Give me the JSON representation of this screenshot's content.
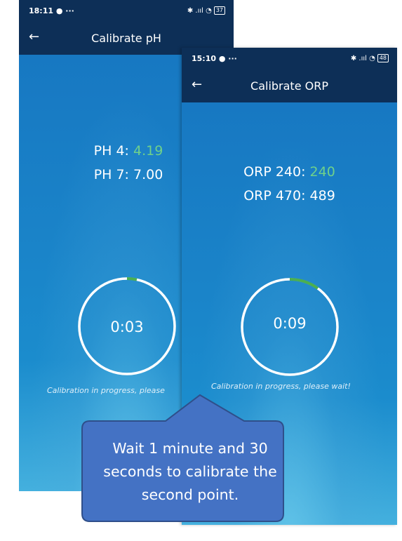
{
  "ph_screen": {
    "status_time": "18:11",
    "status_dots": "● ···",
    "status_icons": "✱ .ııl ◔",
    "battery": "37",
    "title": "Calibrate pH",
    "reading_1_label": "PH 4:",
    "reading_1_value": "4.19",
    "reading_2": "PH 7: 7.00",
    "timer": "0:03",
    "progress_fraction": 0.033,
    "message": "Calibration in progress, please"
  },
  "orp_screen": {
    "status_time": "15:10",
    "status_dots": "● ···",
    "status_icons": "✱ .ııl ◔",
    "battery": "48",
    "title": "Calibrate ORP",
    "reading_1_label": "ORP 240:",
    "reading_1_value": "240",
    "reading_2": "ORP 470: 489",
    "timer": "0:09",
    "progress_fraction": 0.1,
    "message": "Calibration in progress, please wait!"
  },
  "callout": {
    "text_line_1": "Wait 1 minute and 30",
    "text_line_2": "seconds to calibrate the",
    "text_line_3": "second point."
  },
  "colors": {
    "header": "#0d2f57",
    "reading_ok": "#6fd18a",
    "progress_arc": "#4caf50",
    "callout_fill": "#4472c4",
    "callout_border": "#2f4f8a"
  }
}
